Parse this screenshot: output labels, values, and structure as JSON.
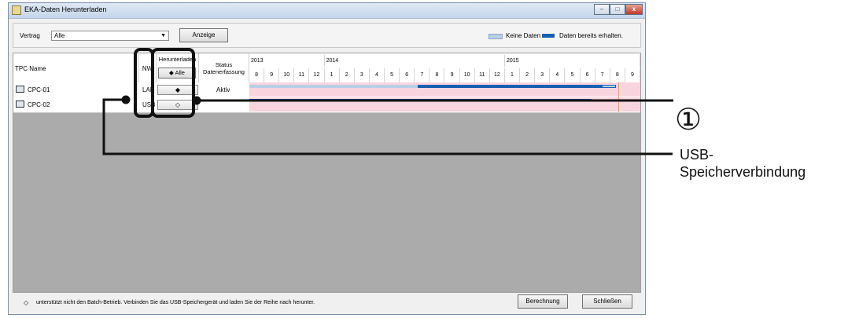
{
  "window": {
    "title": "EKA-Daten Herunterladen",
    "controls": {
      "minimize": "–",
      "maximize": "□",
      "close": "x"
    }
  },
  "toolbar": {
    "contract_label": "Vertrag",
    "contract_value": "Alle",
    "display_button": "Anzeige",
    "legend_no_data": "Keine Daten",
    "legend_received": "Daten bereits erhalten."
  },
  "table": {
    "col_name": "TPC Name",
    "col_nw": "NW",
    "col_download": "Herunterladen",
    "download_all": "◆ Alle",
    "col_status": "Status Datenerfassung",
    "years": [
      "2013",
      "2014",
      "2015"
    ],
    "months": [
      "8",
      "9",
      "10",
      "11",
      "12",
      "1",
      "2",
      "3",
      "4",
      "5",
      "6",
      "7",
      "8",
      "9",
      "10",
      "11",
      "12",
      "1",
      "2",
      "3",
      "4",
      "5",
      "6",
      "7",
      "8",
      "9"
    ],
    "rows": [
      {
        "name": "CPC-01",
        "nw": "LAN",
        "download": "◆",
        "status": "Aktiv"
      },
      {
        "name": "CPC-02",
        "nw": "USB",
        "download": "◇",
        "status": ""
      }
    ]
  },
  "footer": {
    "note_icon": "◇",
    "note": "unterstützt nicht den Batch-Betrieb. Verbinden Sie das USB-Speichergerät und laden Sie der Reihe nach herunter.",
    "calc_button": "Berechnung",
    "close_button": "Schließen"
  },
  "annotation": {
    "number": "①",
    "usb_line1": "USB-",
    "usb_line2": "Speicherverbindung"
  },
  "colors": {
    "no_data": "#b8cfe6",
    "received": "#1560b0",
    "pink_bg": "#f7d4de",
    "current_month": "#f0a030"
  }
}
